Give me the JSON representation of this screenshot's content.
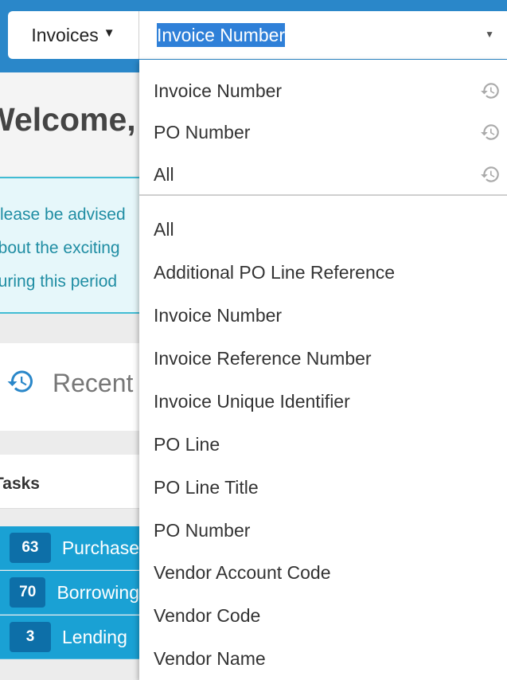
{
  "search": {
    "scope_label": "Invoices",
    "selected_field": "Invoice Number"
  },
  "page": {
    "welcome": "Welcome,",
    "notice_lines": [
      "Please be advised",
      "about the exciting",
      "during this period"
    ],
    "recent_label": "Recent",
    "tasks_title": "Tasks",
    "tasks": [
      {
        "count": "63",
        "name": "Purchase"
      },
      {
        "count": "70",
        "name": "Borrowing"
      },
      {
        "count": "3",
        "name": "Lending"
      }
    ]
  },
  "dropdown": {
    "recent_searches": [
      {
        "label": "Invoice Number",
        "icon": "history-icon"
      },
      {
        "label": "PO Number",
        "icon": "history-icon"
      },
      {
        "label": "All",
        "icon": "history-icon"
      }
    ],
    "fields": [
      "All",
      "Additional PO Line Reference",
      "Invoice Number",
      "Invoice Reference Number",
      "Invoice Unique Identifier",
      "PO Line",
      "PO Line Title",
      "PO Number",
      "Vendor Account Code",
      "Vendor Code",
      "Vendor Name"
    ]
  },
  "colors": {
    "topbar": "#2a87c9",
    "selection": "#2f80d8",
    "task_row": "#1aa1d4",
    "task_badge": "#0d6fa8",
    "notice_text": "#1f8da3"
  }
}
